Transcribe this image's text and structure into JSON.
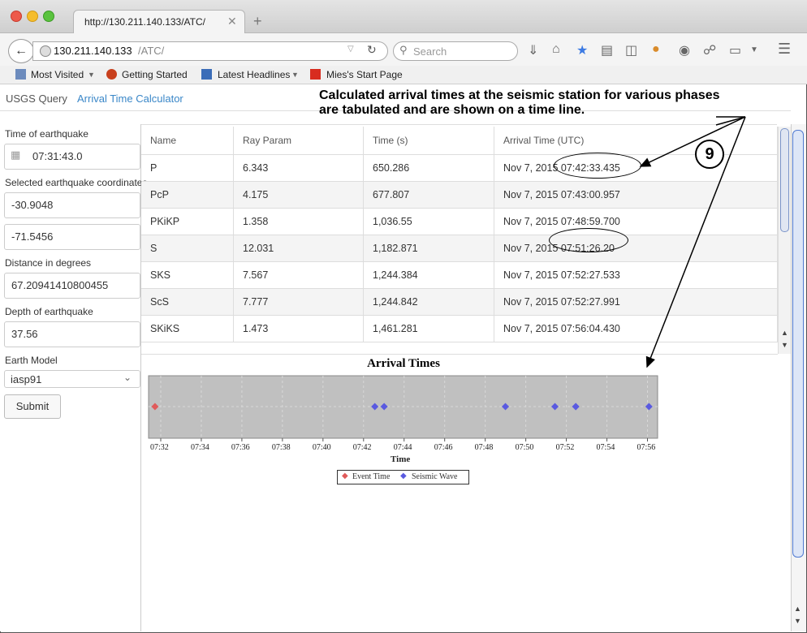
{
  "browser": {
    "tab_title": "http://130.211.140.133/ATC/",
    "tab_close": "✕",
    "new_tab": "+",
    "url_host": "130.211.140.133",
    "url_path": "/ATC/",
    "search_placeholder": "Search",
    "bookmarks": [
      "Most Visited",
      "Getting Started",
      "Latest Headlines",
      "Mies's Start Page"
    ]
  },
  "nav": {
    "tabs": [
      "USGS Query",
      "Arrival Time Calculator"
    ],
    "active_tab": "Arrival Time Calculator"
  },
  "annotation": {
    "text": "Calculated arrival times at the seismic station for various phases are tabulated and are shown on a time line.",
    "step": "9"
  },
  "form": {
    "time_label": "Time of earthquake",
    "time_value": "07:31:43.0",
    "coords_label": "Selected earthquake coordinates",
    "lat_value": "-30.9048",
    "lon_value": "-71.5456",
    "distance_label": "Distance in degrees",
    "distance_value": "67.20941410800455",
    "depth_label": "Depth of earthquake",
    "depth_value": "37.56",
    "model_label": "Earth Model",
    "model_value": "iasp91",
    "submit_label": "Submit"
  },
  "table": {
    "columns": [
      "Name",
      "Ray Param",
      "Time (s)",
      "Arrival Time (UTC)"
    ],
    "rows": [
      [
        "P",
        "6.343",
        "650.286",
        "Nov 7, 2015 07:42:33.435"
      ],
      [
        "PcP",
        "4.175",
        "677.807",
        "Nov 7, 2015 07:43:00.957"
      ],
      [
        "PKiKP",
        "1.358",
        "1,036.55",
        "Nov 7, 2015 07:48:59.700"
      ],
      [
        "S",
        "12.031",
        "1,182.871",
        "Nov 7, 2015 07:51:26.20"
      ],
      [
        "SKS",
        "7.567",
        "1,244.384",
        "Nov 7, 2015 07:52:27.533"
      ],
      [
        "ScS",
        "7.777",
        "1,244.842",
        "Nov 7, 2015 07:52:27.991"
      ],
      [
        "SKiKS",
        "1.473",
        "1,461.281",
        "Nov 7, 2015 07:56:04.430"
      ]
    ]
  },
  "chart_data": {
    "type": "scatter",
    "title": "Arrival Times",
    "xlabel": "Time",
    "ylabel": "",
    "x_ticks": [
      "07:32",
      "07:34",
      "07:36",
      "07:38",
      "07:40",
      "07:42",
      "07:44",
      "07:46",
      "07:48",
      "07:50",
      "07:52",
      "07:54",
      "07:56"
    ],
    "xlim_minutes": [
      31.4,
      56.5
    ],
    "grid": true,
    "legend_position": "bottom",
    "series": [
      {
        "name": "Event Time",
        "color": "#e05a5a",
        "x": [
          "07:31:43.0"
        ],
        "x_minutes": [
          31.717
        ]
      },
      {
        "name": "Seismic Wave",
        "color": "#5a5ae0",
        "x": [
          "07:42:33.435",
          "07:43:00.957",
          "07:48:59.700",
          "07:51:26.20",
          "07:52:27.533",
          "07:52:27.991",
          "07:56:04.430"
        ],
        "x_minutes": [
          42.557,
          43.016,
          48.995,
          51.437,
          52.459,
          52.467,
          56.074
        ]
      }
    ]
  }
}
